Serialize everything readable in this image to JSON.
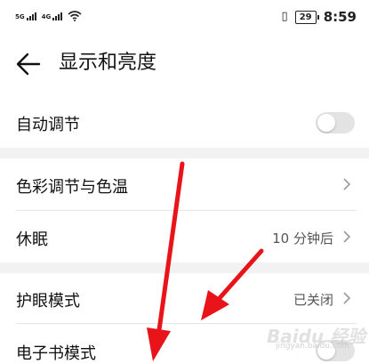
{
  "status_bar": {
    "sim1_tag": "5G",
    "sim2_tag": "4G",
    "battery": "29",
    "time": "8:59"
  },
  "header": {
    "back_icon": "back-arrow-icon",
    "title": "显示和亮度"
  },
  "settings": {
    "auto_adjust": {
      "label": "自动调节",
      "toggle_on": false
    },
    "color_temp": {
      "label": "色彩调节与色温"
    },
    "sleep": {
      "label": "休眠",
      "value": "10 分钟后"
    },
    "eye_comfort": {
      "label": "护眼模式",
      "value": "已关闭"
    },
    "ebook_mode": {
      "label": "电子书模式",
      "toggle_on": false
    }
  },
  "colors": {
    "annotation_arrow": "#e8141a",
    "toggle_off": "#e3e3e3",
    "section_gap": "#f2f2f2"
  },
  "watermark": {
    "text": "Baidu 经验",
    "sub": "jingyan.baidu.com"
  }
}
